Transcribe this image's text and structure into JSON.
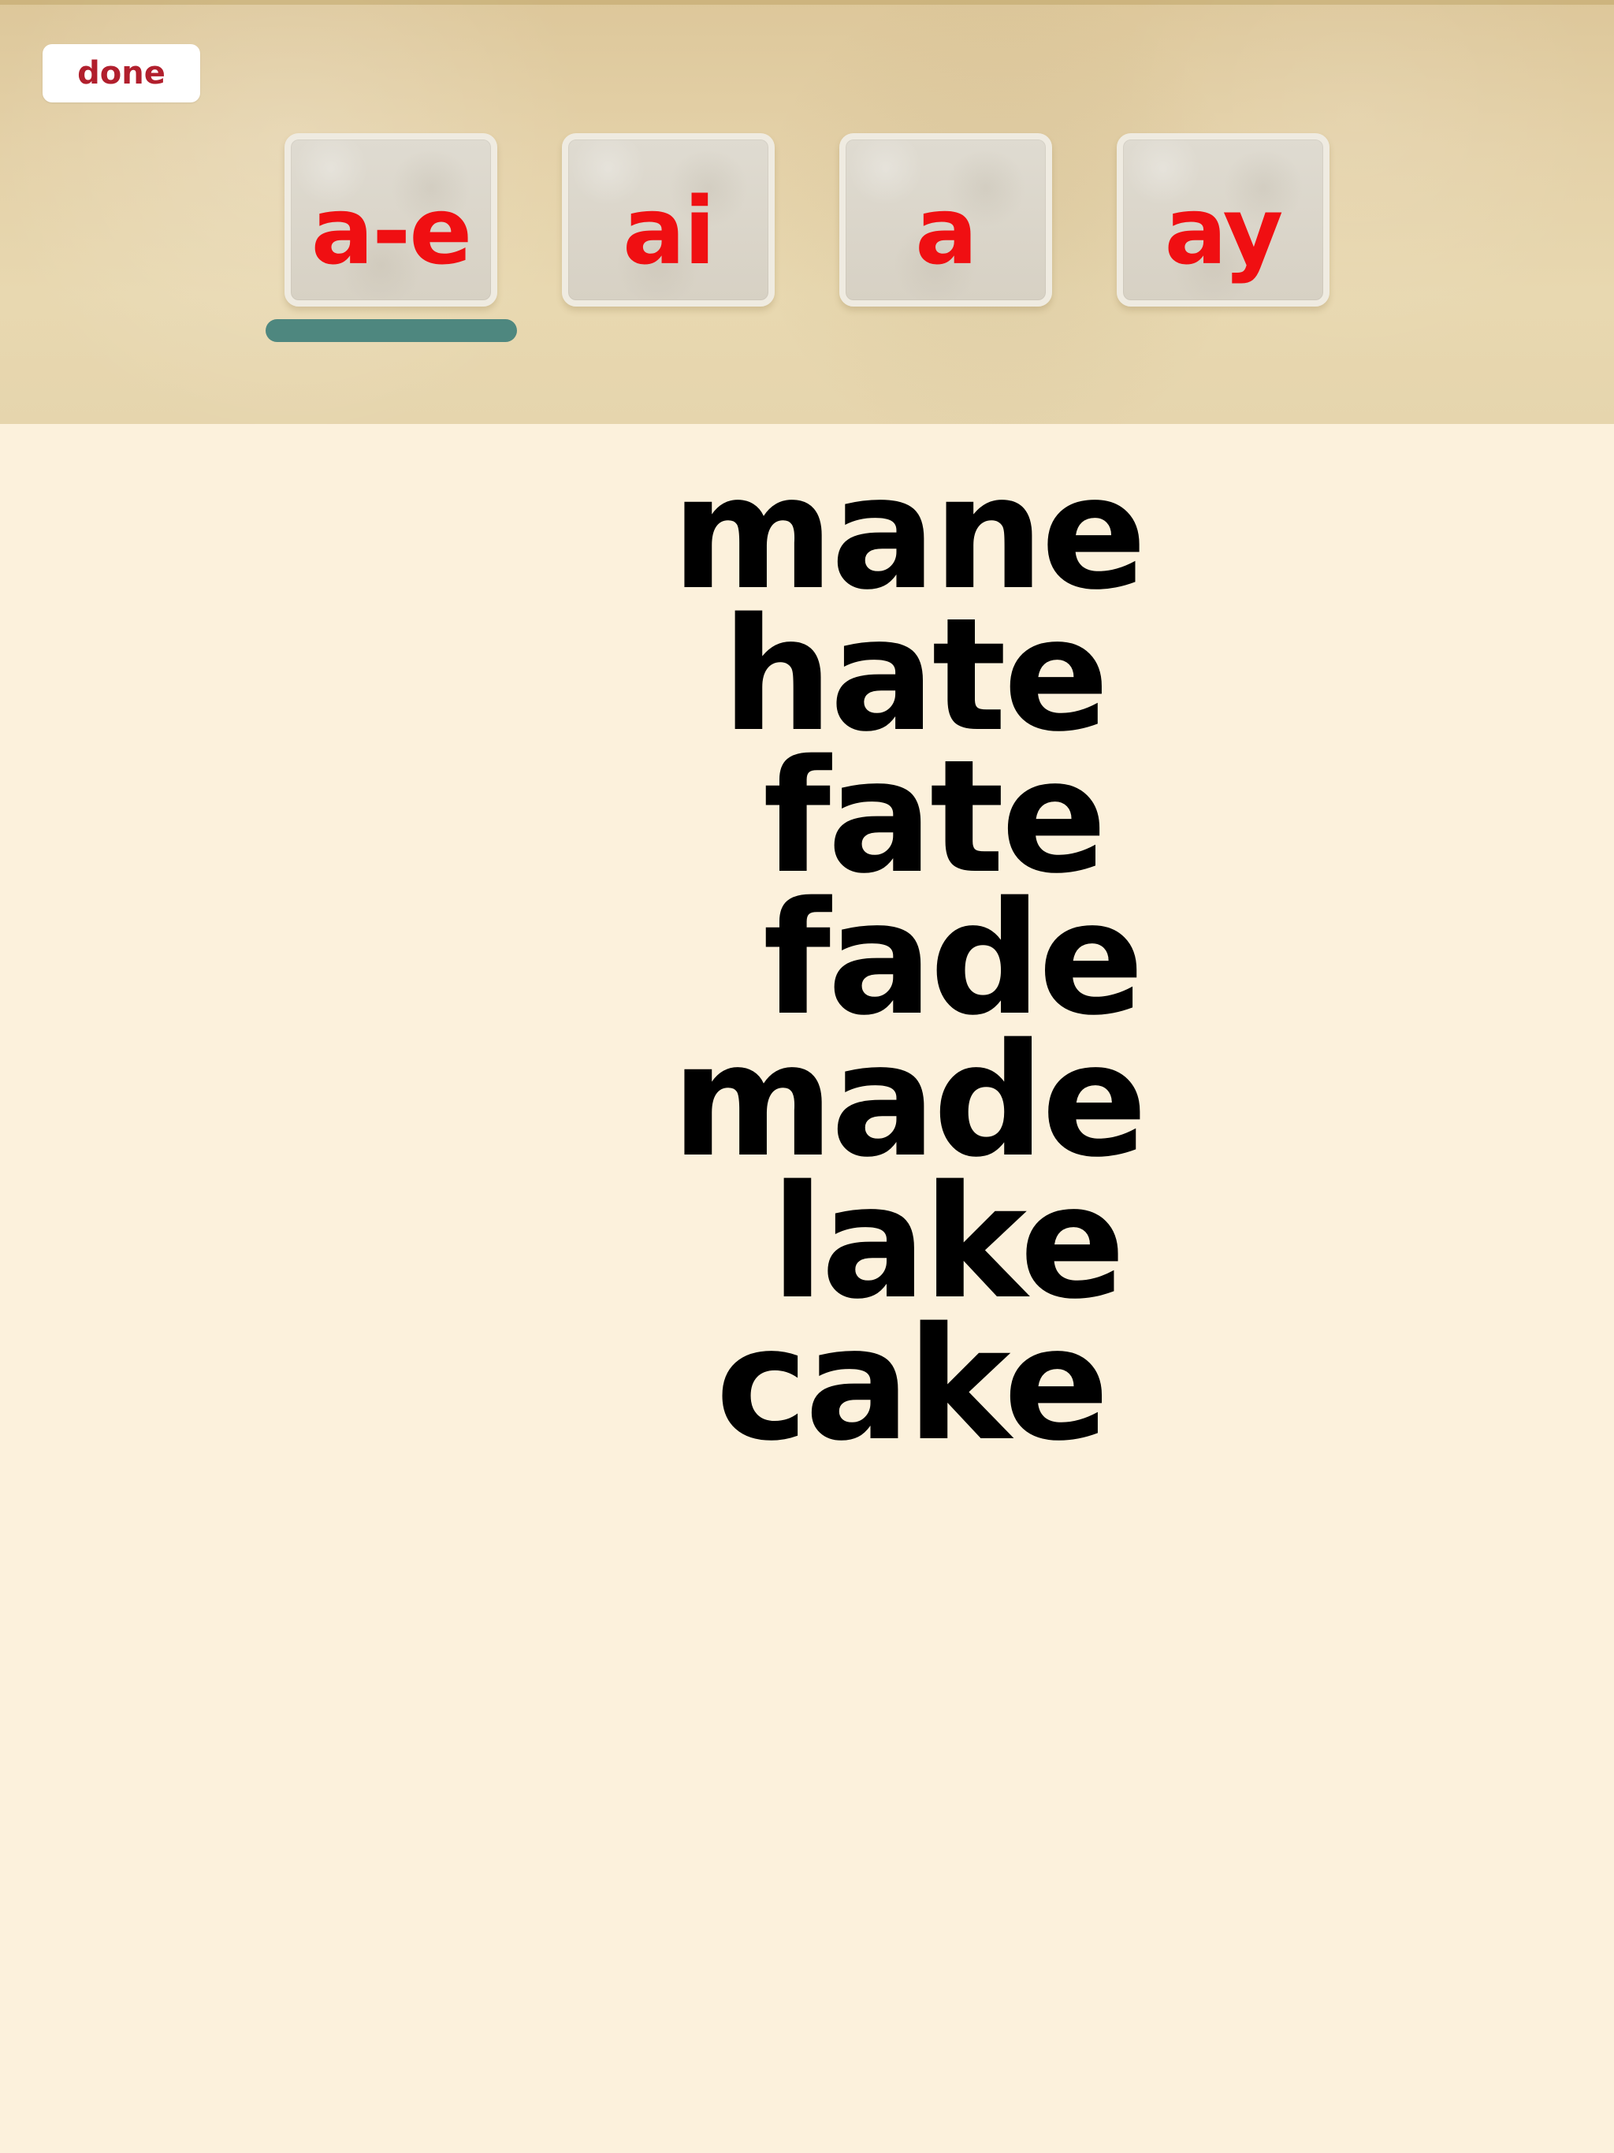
{
  "header": {
    "done_label": "done",
    "tiles": [
      {
        "label": "a-e",
        "selected": true
      },
      {
        "label": "ai",
        "selected": false
      },
      {
        "label": "a",
        "selected": false
      },
      {
        "label": "ay",
        "selected": false
      }
    ]
  },
  "words": [
    "mane",
    "hate",
    "fate",
    "fade",
    "made",
    "lake",
    "cake"
  ],
  "colors": {
    "background": "#fcf1dc",
    "header": "#e4d1a8",
    "tile_text": "#f00f12",
    "done_text": "#b11f2d",
    "selection_indicator": "#4e877f",
    "word_text": "#000000"
  }
}
